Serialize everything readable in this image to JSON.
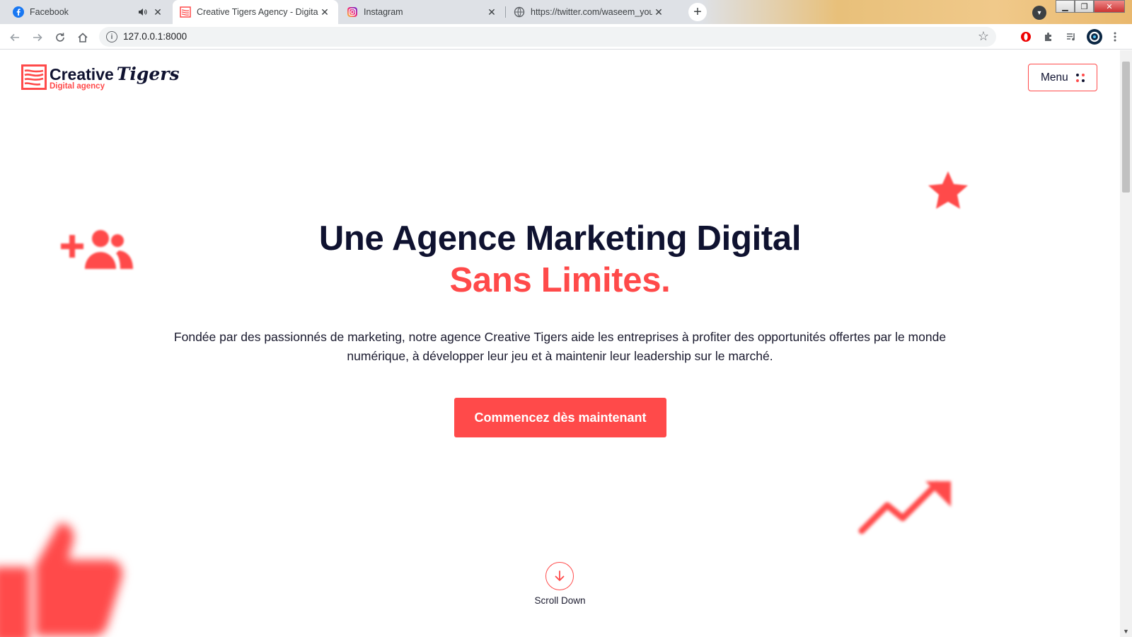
{
  "browser": {
    "tabs": [
      {
        "title": "Facebook",
        "icon": "facebook-icon",
        "muted_icon": "speaker-icon"
      },
      {
        "title": "Creative Tigers Agency - Digital M",
        "icon": "creative-tigers-favicon",
        "active": true
      },
      {
        "title": "Instagram",
        "icon": "instagram-icon"
      },
      {
        "title": "https://twitter.com/waseem_your",
        "icon": "globe-icon"
      }
    ],
    "new_tab_label": "+",
    "url": "127.0.0.1:8000",
    "colors": {
      "accent": "#ff4a4a",
      "navy": "#0f1230"
    }
  },
  "site": {
    "logo": {
      "name_part1": "Creative",
      "name_part2": "Tigers",
      "tagline": "Digital agency"
    },
    "menu_label": "Menu",
    "hero": {
      "title_line1": "Une Agence Marketing Digital",
      "title_line2": "Sans Limites.",
      "description": "Fondée par des passionnés de marketing, notre agence Creative Tigers aide les entreprises à profiter des opportunités offertes par le monde numérique, à développer leur jeu et à maintenir leur leadership sur le marché.",
      "cta_label": "Commencez dès maintenant"
    },
    "scroll_label": "Scroll Down",
    "decorations": [
      "add-users-icon",
      "star-icon",
      "trend-arrow-icon",
      "thumbs-up-icon"
    ]
  }
}
